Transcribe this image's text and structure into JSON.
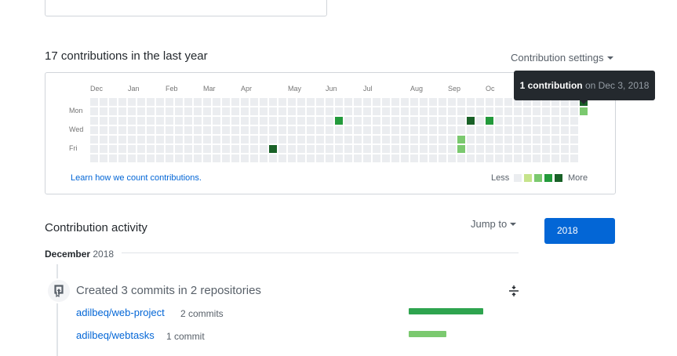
{
  "calendar": {
    "title": "17 contributions in the last year",
    "settings_label": "Contribution settings",
    "months": [
      {
        "label": "Dec",
        "col": 0
      },
      {
        "label": "Jan",
        "col": 4
      },
      {
        "label": "Feb",
        "col": 8
      },
      {
        "label": "Mar",
        "col": 12
      },
      {
        "label": "Apr",
        "col": 16
      },
      {
        "label": "May",
        "col": 21
      },
      {
        "label": "Jun",
        "col": 25
      },
      {
        "label": "Jul",
        "col": 29
      },
      {
        "label": "Aug",
        "col": 34
      },
      {
        "label": "Sep",
        "col": 38
      },
      {
        "label": "Oc",
        "col": 42
      }
    ],
    "weekdays": [
      {
        "label": "Mon",
        "row": 1
      },
      {
        "label": "Wed",
        "row": 3
      },
      {
        "label": "Fri",
        "row": 5
      }
    ],
    "weeks": 53,
    "last_week_days": 2,
    "colors": [
      "#ebedf0",
      "#c6e48b",
      "#7bc96f",
      "#239a3b",
      "#196127"
    ],
    "contributions": [
      {
        "col": 19,
        "row": 5,
        "level": 4
      },
      {
        "col": 26,
        "row": 2,
        "level": 3
      },
      {
        "col": 39,
        "row": 4,
        "level": 2
      },
      {
        "col": 39,
        "row": 5,
        "level": 2
      },
      {
        "col": 40,
        "row": 2,
        "level": 4
      },
      {
        "col": 42,
        "row": 2,
        "level": 3
      },
      {
        "col": 52,
        "row": 0,
        "level": 4
      },
      {
        "col": 52,
        "row": 1,
        "level": 2
      }
    ],
    "learn_link": "Learn how we count contributions.",
    "legend_less": "Less",
    "legend_more": "More",
    "tooltip": {
      "bold": "1 contribution",
      "rest": "on Dec 3, 2018"
    }
  },
  "activity": {
    "title": "Contribution activity",
    "jump_to": "Jump to",
    "year_button": "2018",
    "month_label": "December",
    "month_year": "2018",
    "summary": "Created 3 commits in 2 repositories",
    "repos": [
      {
        "name": "adilbeq/web-project",
        "count": "2 commits",
        "fraction": 1.0
      },
      {
        "name": "adilbeq/webtasks",
        "count": "1 commit",
        "fraction": 0.5
      }
    ],
    "bar_colors": [
      "#2ea44f",
      "#7bc96f"
    ]
  }
}
